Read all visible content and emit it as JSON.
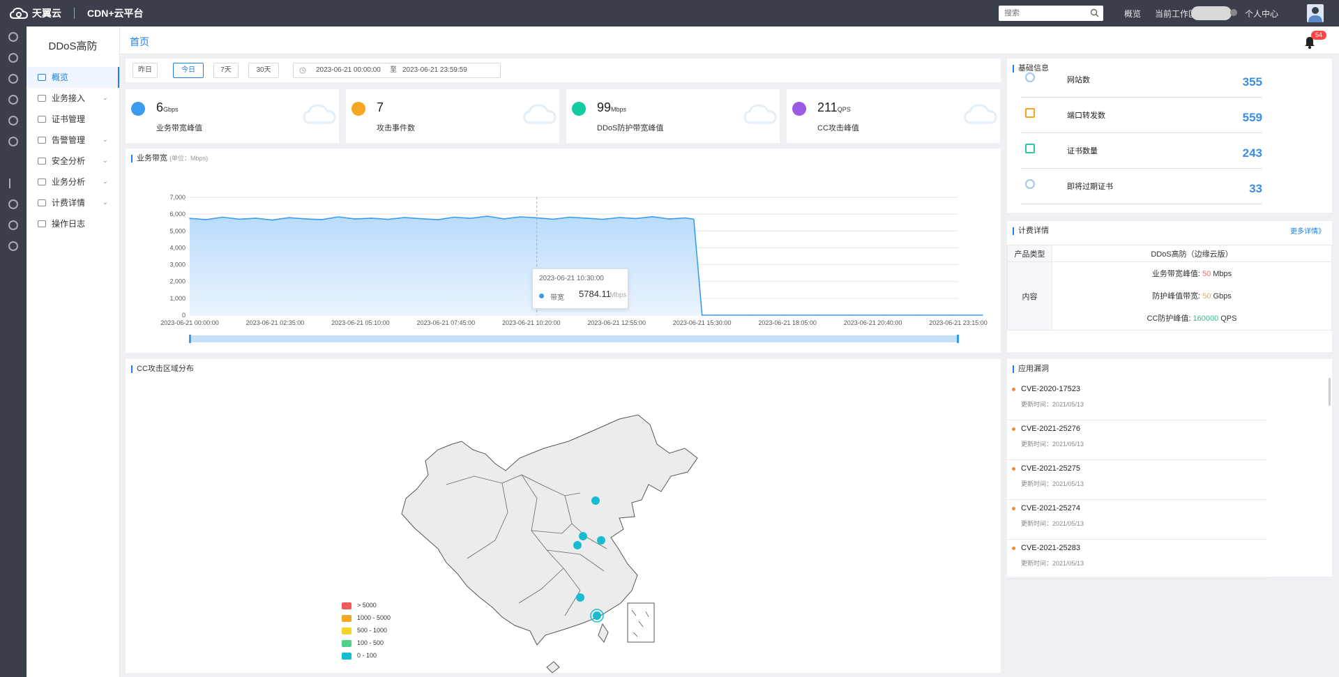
{
  "topbar": {
    "brand_primary": "天翼云",
    "brand_secondary": "CDN+云平台",
    "search_placeholder": "搜索",
    "links": [
      "概览",
      "当前工作区",
      "个人中心"
    ]
  },
  "sidebar": {
    "title": "DDoS高防",
    "items": [
      {
        "label": "概览",
        "active": true,
        "expandable": false,
        "icon": "dashboard-icon"
      },
      {
        "label": "业务接入",
        "active": false,
        "expandable": true,
        "icon": "globe-icon"
      },
      {
        "label": "证书管理",
        "active": false,
        "expandable": false,
        "icon": "certificate-icon"
      },
      {
        "label": "告警管理",
        "active": false,
        "expandable": true,
        "icon": "alarm-icon"
      },
      {
        "label": "安全分析",
        "active": false,
        "expandable": true,
        "icon": "shield-icon"
      },
      {
        "label": "业务分析",
        "active": false,
        "expandable": true,
        "icon": "grid-icon"
      },
      {
        "label": "计费详情",
        "active": false,
        "expandable": true,
        "icon": "billing-icon"
      },
      {
        "label": "操作日志",
        "active": false,
        "expandable": false,
        "icon": "log-icon"
      }
    ]
  },
  "breadcrumb": {
    "label": "首页"
  },
  "notifications": {
    "count": "54"
  },
  "filters": {
    "buttons": [
      "昨日",
      "今日",
      "7天",
      "30天"
    ],
    "active_index": 1,
    "start": "2023-06-21 00:00:00",
    "sep": "至",
    "end": "2023-06-21 23:59:59"
  },
  "stats": [
    {
      "value": "6",
      "unit": "Gbps",
      "label": "业务带宽峰值",
      "color": "#3a9cf0"
    },
    {
      "value": "7",
      "unit": "",
      "label": "攻击事件数",
      "color": "#f5a623"
    },
    {
      "value": "99",
      "unit": "Mbps",
      "label": "DDoS防护带宽峰值",
      "color": "#13cba1"
    },
    {
      "value": "211",
      "unit": "QPS",
      "label": "CC攻击峰值",
      "color": "#9b59e6"
    }
  ],
  "bandwidth_chart": {
    "title": "业务带宽",
    "unit_note": "(单位：Mbps)",
    "tooltip": {
      "time": "2023-06-21 10:30:00",
      "series": "带宽",
      "value": "5784.11",
      "unit": "Mbps"
    }
  },
  "chart_data": {
    "type": "area",
    "xlabel": "",
    "ylabel": "",
    "ylim": [
      0,
      7000
    ],
    "yticks": [
      "7,000",
      "6,000",
      "5,000",
      "4,000",
      "3,000",
      "2,000",
      "1,000",
      "0"
    ],
    "xticks": [
      "2023-06-21 00:00:00",
      "2023-06-21 02:35:00",
      "2023-06-21 05:10:00",
      "2023-06-21 07:45:00",
      "2023-06-21 10:20:00",
      "2023-06-21 12:55:00",
      "2023-06-21 15:30:00",
      "2023-06-21 18:05:00",
      "2023-06-21 20:40:00",
      "2023-06-21 23:15:00"
    ],
    "series": [
      {
        "x": [
          "00:00",
          "00:30",
          "01:00",
          "01:30",
          "02:00",
          "02:30",
          "03:00",
          "03:30",
          "04:00",
          "04:30",
          "05:00",
          "05:30",
          "06:00",
          "06:30",
          "07:00",
          "07:30",
          "08:00",
          "08:30",
          "09:00",
          "09:30",
          "10:00",
          "10:30",
          "11:00",
          "11:30",
          "12:00",
          "12:30",
          "13:00",
          "13:30",
          "14:00",
          "14:30",
          "15:00",
          "15:15",
          "15:30",
          "16:00",
          "17:00",
          "18:00",
          "19:00",
          "20:00",
          "21:00",
          "22:00",
          "23:00",
          "23:59"
        ],
        "values": [
          5750,
          5680,
          5820,
          5700,
          5760,
          5650,
          5790,
          5720,
          5680,
          5840,
          5710,
          5760,
          5690,
          5800,
          5730,
          5670,
          5820,
          5750,
          5880,
          5720,
          5840,
          5784,
          5700,
          5820,
          5760,
          5690,
          5800,
          5740,
          5850,
          5710,
          5780,
          5700,
          0,
          0,
          0,
          0,
          0,
          0,
          0,
          0,
          0,
          0
        ]
      }
    ]
  },
  "cc_map": {
    "title": "CC攻击区域分布",
    "legend": [
      {
        "label": "> 5000",
        "color": "#f05a5a"
      },
      {
        "label": "1000 - 5000",
        "color": "#f5a623"
      },
      {
        "label": "500 - 1000",
        "color": "#f5d42a"
      },
      {
        "label": "100 - 500",
        "color": "#4fd18b"
      },
      {
        "label": "0 - 100",
        "color": "#17bcd0"
      }
    ]
  },
  "basic_info": {
    "title": "基础信息",
    "rows": [
      {
        "label": "网站数",
        "value": "355",
        "icon": "website-icon"
      },
      {
        "label": "端口转发数",
        "value": "559",
        "icon": "port-forward-icon"
      },
      {
        "label": "证书数量",
        "value": "243",
        "icon": "certificate-icon"
      },
      {
        "label": "即将过期证书",
        "value": "33",
        "icon": "expiring-cert-icon"
      }
    ]
  },
  "billing": {
    "title": "计费详情",
    "more": "更多详情》",
    "product_type_label": "产品类型",
    "product_type_value": "DDoS高防（边缘云版）",
    "content_label": "内容",
    "lines": [
      {
        "label": "业务带宽峰值:",
        "value": "50",
        "unit": "Mbps",
        "color": "#e96a6a"
      },
      {
        "label": "防护峰值带宽:",
        "value": "50",
        "unit": "Gbps",
        "color": "#f0a64b"
      },
      {
        "label": "CC防护峰值:",
        "value": "160000",
        "unit": "QPS",
        "color": "#2fbf8a"
      }
    ]
  },
  "vulns": {
    "title": "应用漏洞",
    "items": [
      {
        "name": "CVE-2020-17523",
        "date": "更新时间：2021/05/13"
      },
      {
        "name": "CVE-2021-25276",
        "date": "更新时间：2021/05/13"
      },
      {
        "name": "CVE-2021-25275",
        "date": "更新时间：2021/05/13"
      },
      {
        "name": "CVE-2021-25274",
        "date": "更新时间：2021/05/13"
      },
      {
        "name": "CVE-2021-25283",
        "date": "更新时间：2021/05/13"
      }
    ]
  }
}
